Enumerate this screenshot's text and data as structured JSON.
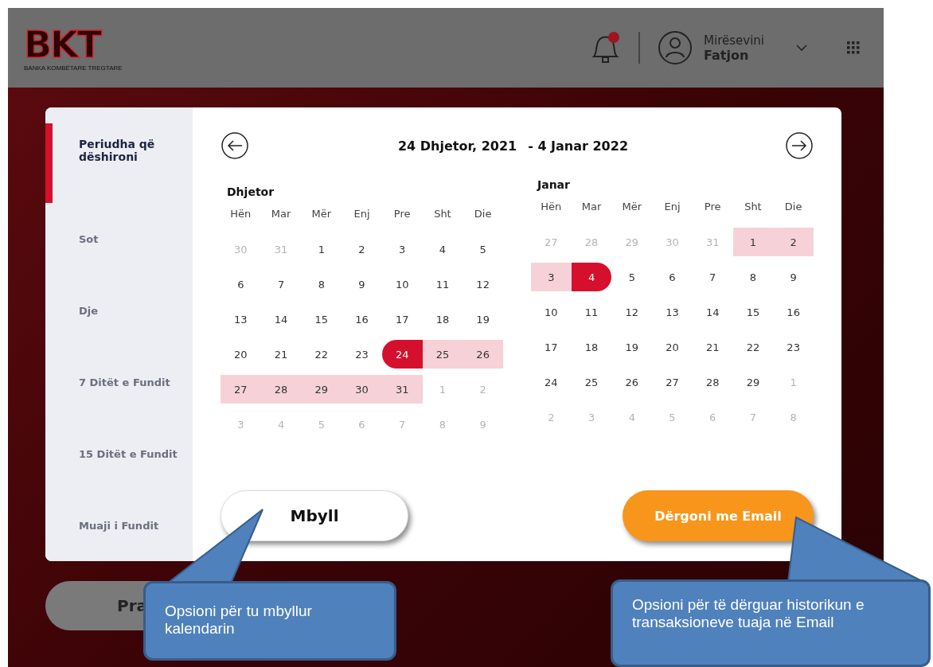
{
  "header": {
    "logo": {
      "mark": "BKT",
      "subtitle": "BANKA KOMBËTARE TREGTARE"
    },
    "notifications": {
      "unread": true
    },
    "user": {
      "greeting": "Mirësevini",
      "name": "Fatjon"
    }
  },
  "date_picker": {
    "sidebar": [
      {
        "label": "Periudha që dëshironi",
        "selected": true
      },
      {
        "label": "Sot",
        "selected": false
      },
      {
        "label": "Dje",
        "selected": false
      },
      {
        "label": "7 Ditët e Fundit",
        "selected": false
      },
      {
        "label": "15 Ditët e Fundit",
        "selected": false
      },
      {
        "label": "Muaji i Fundit",
        "selected": false
      }
    ],
    "range_start": "24 Dhjetor, 2021",
    "range_end": "- 4 Janar 2022",
    "months": [
      {
        "title": "Dhjetor",
        "weekdays": [
          "Hën",
          "Mar",
          "Mër",
          "Enj",
          "Pre",
          "Sht",
          "Die"
        ],
        "weeks": [
          [
            {
              "d": "30",
              "muted": true,
              "range_start": false,
              "range_end": false,
              "in_range": false
            },
            {
              "d": "31",
              "muted": true,
              "range_start": false,
              "range_end": false,
              "in_range": false
            },
            {
              "d": "1",
              "muted": false,
              "range_start": false,
              "range_end": false,
              "in_range": false
            },
            {
              "d": "2",
              "muted": false,
              "range_start": false,
              "range_end": false,
              "in_range": false
            },
            {
              "d": "3",
              "muted": false,
              "range_start": false,
              "range_end": false,
              "in_range": false
            },
            {
              "d": "4",
              "muted": false,
              "range_start": false,
              "range_end": false,
              "in_range": false
            },
            {
              "d": "5",
              "muted": false,
              "range_start": false,
              "range_end": false,
              "in_range": false
            }
          ],
          [
            {
              "d": "6",
              "muted": false,
              "range_start": false,
              "range_end": false,
              "in_range": false
            },
            {
              "d": "7",
              "muted": false,
              "range_start": false,
              "range_end": false,
              "in_range": false
            },
            {
              "d": "8",
              "muted": false,
              "range_start": false,
              "range_end": false,
              "in_range": false
            },
            {
              "d": "9",
              "muted": false,
              "range_start": false,
              "range_end": false,
              "in_range": false
            },
            {
              "d": "10",
              "muted": false,
              "range_start": false,
              "range_end": false,
              "in_range": false
            },
            {
              "d": "11",
              "muted": false,
              "range_start": false,
              "range_end": false,
              "in_range": false
            },
            {
              "d": "12",
              "muted": false,
              "range_start": false,
              "range_end": false,
              "in_range": false
            }
          ],
          [
            {
              "d": "13",
              "muted": false,
              "range_start": false,
              "range_end": false,
              "in_range": false
            },
            {
              "d": "14",
              "muted": false,
              "range_start": false,
              "range_end": false,
              "in_range": false
            },
            {
              "d": "15",
              "muted": false,
              "range_start": false,
              "range_end": false,
              "in_range": false
            },
            {
              "d": "16",
              "muted": false,
              "range_start": false,
              "range_end": false,
              "in_range": false
            },
            {
              "d": "17",
              "muted": false,
              "range_start": false,
              "range_end": false,
              "in_range": false
            },
            {
              "d": "18",
              "muted": false,
              "range_start": false,
              "range_end": false,
              "in_range": false
            },
            {
              "d": "19",
              "muted": false,
              "range_start": false,
              "range_end": false,
              "in_range": false
            }
          ],
          [
            {
              "d": "20",
              "muted": false,
              "range_start": false,
              "range_end": false,
              "in_range": false
            },
            {
              "d": "21",
              "muted": false,
              "range_start": false,
              "range_end": false,
              "in_range": false
            },
            {
              "d": "22",
              "muted": false,
              "range_start": false,
              "range_end": false,
              "in_range": false
            },
            {
              "d": "23",
              "muted": false,
              "range_start": false,
              "range_end": false,
              "in_range": false
            },
            {
              "d": "24",
              "muted": false,
              "range_start": true,
              "range_end": false,
              "in_range": true
            },
            {
              "d": "25",
              "muted": false,
              "range_start": false,
              "range_end": false,
              "in_range": true
            },
            {
              "d": "26",
              "muted": false,
              "range_start": false,
              "range_end": false,
              "in_range": true
            }
          ],
          [
            {
              "d": "27",
              "muted": false,
              "range_start": false,
              "range_end": false,
              "in_range": true
            },
            {
              "d": "28",
              "muted": false,
              "range_start": false,
              "range_end": false,
              "in_range": true
            },
            {
              "d": "29",
              "muted": false,
              "range_start": false,
              "range_end": false,
              "in_range": true
            },
            {
              "d": "30",
              "muted": false,
              "range_start": false,
              "range_end": false,
              "in_range": true
            },
            {
              "d": "31",
              "muted": false,
              "range_start": false,
              "range_end": false,
              "in_range": true
            },
            {
              "d": "1",
              "muted": true,
              "range_start": false,
              "range_end": false,
              "in_range": false
            },
            {
              "d": "2",
              "muted": true,
              "range_start": false,
              "range_end": false,
              "in_range": false
            }
          ],
          [
            {
              "d": "3",
              "muted": true,
              "range_start": false,
              "range_end": false,
              "in_range": false
            },
            {
              "d": "4",
              "muted": true,
              "range_start": false,
              "range_end": false,
              "in_range": false
            },
            {
              "d": "5",
              "muted": true,
              "range_start": false,
              "range_end": false,
              "in_range": false
            },
            {
              "d": "6",
              "muted": true,
              "range_start": false,
              "range_end": false,
              "in_range": false
            },
            {
              "d": "7",
              "muted": true,
              "range_start": false,
              "range_end": false,
              "in_range": false
            },
            {
              "d": "8",
              "muted": true,
              "range_start": false,
              "range_end": false,
              "in_range": false
            },
            {
              "d": "9",
              "muted": true,
              "range_start": false,
              "range_end": false,
              "in_range": false
            }
          ]
        ]
      },
      {
        "title": "Janar",
        "weekdays": [
          "Hën",
          "Mar",
          "Mër",
          "Enj",
          "Pre",
          "Sht",
          "Die"
        ],
        "weeks": [
          [
            {
              "d": "27",
              "muted": true,
              "range_start": false,
              "range_end": false,
              "in_range": false
            },
            {
              "d": "28",
              "muted": true,
              "range_start": false,
              "range_end": false,
              "in_range": false
            },
            {
              "d": "29",
              "muted": true,
              "range_start": false,
              "range_end": false,
              "in_range": false
            },
            {
              "d": "30",
              "muted": true,
              "range_start": false,
              "range_end": false,
              "in_range": false
            },
            {
              "d": "31",
              "muted": true,
              "range_start": false,
              "range_end": false,
              "in_range": false
            },
            {
              "d": "1",
              "muted": false,
              "range_start": false,
              "range_end": false,
              "in_range": true
            },
            {
              "d": "2",
              "muted": false,
              "range_start": false,
              "range_end": false,
              "in_range": true
            }
          ],
          [
            {
              "d": "3",
              "muted": false,
              "range_start": false,
              "range_end": false,
              "in_range": true
            },
            {
              "d": "4",
              "muted": false,
              "range_start": false,
              "range_end": true,
              "in_range": true
            },
            {
              "d": "5",
              "muted": false,
              "range_start": false,
              "range_end": false,
              "in_range": false
            },
            {
              "d": "6",
              "muted": false,
              "range_start": false,
              "range_end": false,
              "in_range": false
            },
            {
              "d": "7",
              "muted": false,
              "range_start": false,
              "range_end": false,
              "in_range": false
            },
            {
              "d": "8",
              "muted": false,
              "range_start": false,
              "range_end": false,
              "in_range": false
            },
            {
              "d": "9",
              "muted": false,
              "range_start": false,
              "range_end": false,
              "in_range": false
            }
          ],
          [
            {
              "d": "10",
              "muted": false,
              "range_start": false,
              "range_end": false,
              "in_range": false
            },
            {
              "d": "11",
              "muted": false,
              "range_start": false,
              "range_end": false,
              "in_range": false
            },
            {
              "d": "12",
              "muted": false,
              "range_start": false,
              "range_end": false,
              "in_range": false
            },
            {
              "d": "13",
              "muted": false,
              "range_start": false,
              "range_end": false,
              "in_range": false
            },
            {
              "d": "14",
              "muted": false,
              "range_start": false,
              "range_end": false,
              "in_range": false
            },
            {
              "d": "15",
              "muted": false,
              "range_start": false,
              "range_end": false,
              "in_range": false
            },
            {
              "d": "16",
              "muted": false,
              "range_start": false,
              "range_end": false,
              "in_range": false
            }
          ],
          [
            {
              "d": "17",
              "muted": false,
              "range_start": false,
              "range_end": false,
              "in_range": false
            },
            {
              "d": "18",
              "muted": false,
              "range_start": false,
              "range_end": false,
              "in_range": false
            },
            {
              "d": "19",
              "muted": false,
              "range_start": false,
              "range_end": false,
              "in_range": false
            },
            {
              "d": "20",
              "muted": false,
              "range_start": false,
              "range_end": false,
              "in_range": false
            },
            {
              "d": "21",
              "muted": false,
              "range_start": false,
              "range_end": false,
              "in_range": false
            },
            {
              "d": "22",
              "muted": false,
              "range_start": false,
              "range_end": false,
              "in_range": false
            },
            {
              "d": "23",
              "muted": false,
              "range_start": false,
              "range_end": false,
              "in_range": false
            }
          ],
          [
            {
              "d": "24",
              "muted": false,
              "range_start": false,
              "range_end": false,
              "in_range": false
            },
            {
              "d": "25",
              "muted": false,
              "range_start": false,
              "range_end": false,
              "in_range": false
            },
            {
              "d": "26",
              "muted": false,
              "range_start": false,
              "range_end": false,
              "in_range": false
            },
            {
              "d": "27",
              "muted": false,
              "range_start": false,
              "range_end": false,
              "in_range": false
            },
            {
              "d": "28",
              "muted": false,
              "range_start": false,
              "range_end": false,
              "in_range": false
            },
            {
              "d": "29",
              "muted": false,
              "range_start": false,
              "range_end": false,
              "in_range": false
            },
            {
              "d": "1",
              "muted": true,
              "range_start": false,
              "range_end": false,
              "in_range": false
            }
          ],
          [
            {
              "d": "2",
              "muted": true,
              "range_start": false,
              "range_end": false,
              "in_range": false
            },
            {
              "d": "3",
              "muted": true,
              "range_start": false,
              "range_end": false,
              "in_range": false
            },
            {
              "d": "4",
              "muted": true,
              "range_start": false,
              "range_end": false,
              "in_range": false
            },
            {
              "d": "5",
              "muted": true,
              "range_start": false,
              "range_end": false,
              "in_range": false
            },
            {
              "d": "6",
              "muted": true,
              "range_start": false,
              "range_end": false,
              "in_range": false
            },
            {
              "d": "7",
              "muted": true,
              "range_start": false,
              "range_end": false,
              "in_range": false
            },
            {
              "d": "8",
              "muted": true,
              "range_start": false,
              "range_end": false,
              "in_range": false
            }
          ]
        ]
      }
    ],
    "close_button": "Mbyll",
    "email_button": "Dërgoni me Email"
  },
  "background_button": "Pra",
  "callouts": [
    {
      "text": "Opsioni për tu mbyllur kalendarin"
    },
    {
      "text": "Opsioni për të dërguar historikun e transaksioneve tuaja në Email"
    }
  ]
}
